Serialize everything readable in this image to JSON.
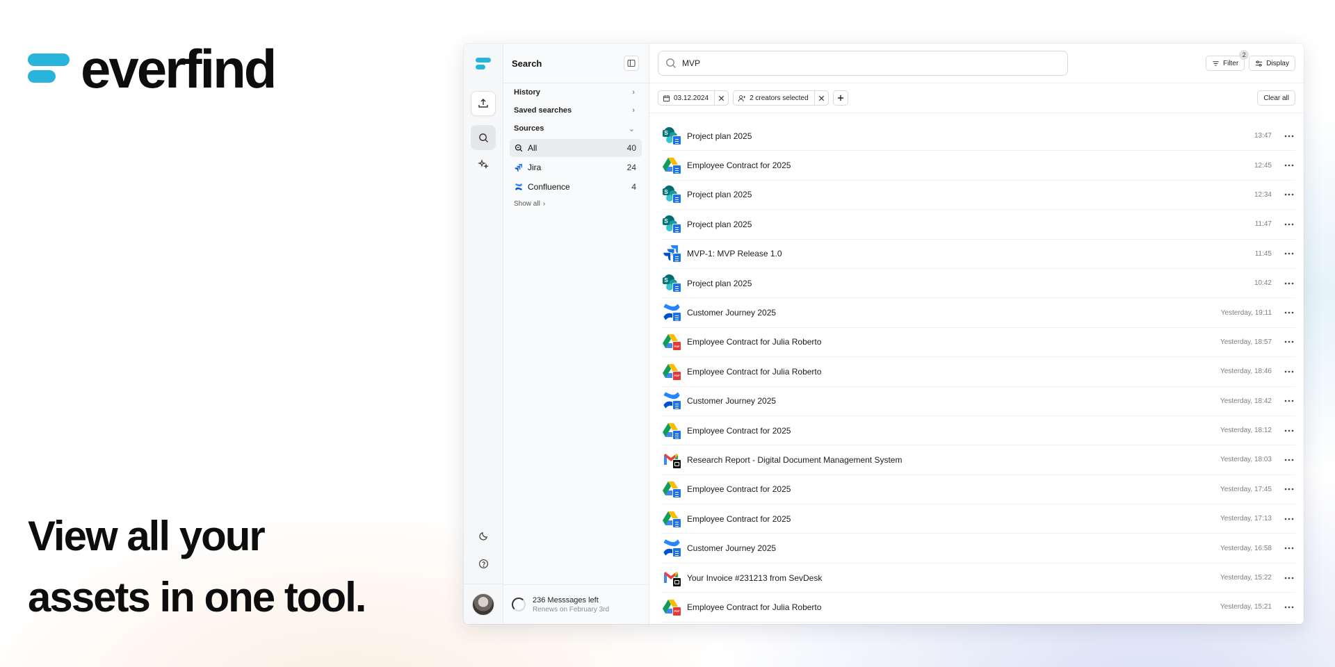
{
  "brand": {
    "name": "everfind"
  },
  "headline": {
    "line1": "View all your",
    "line2": "assets in one tool."
  },
  "colors": {
    "brand": "#29b4dc",
    "sharepoint": "#036c70",
    "docs": "#1a73e8",
    "pdf": "#e53935",
    "confluence": "#2684ff"
  },
  "rail": {
    "icons": [
      "upload-icon",
      "search-icon",
      "sparkle-icon",
      "moon-icon",
      "help-icon"
    ]
  },
  "sidebar": {
    "title": "Search",
    "sections": [
      {
        "label": "History"
      },
      {
        "label": "Saved searches"
      },
      {
        "label": "Sources"
      }
    ],
    "sources": [
      {
        "label": "All",
        "count": "40",
        "icon": "search-all-icon"
      },
      {
        "label": "Jira",
        "count": "24",
        "icon": "jira-icon"
      },
      {
        "label": "Confluence",
        "count": "4",
        "icon": "confluence-icon"
      }
    ],
    "show_all": "Show all",
    "footer": {
      "messages": "236 Messsages left",
      "renews": "Renews on February 3rd"
    }
  },
  "search": {
    "value": "MVP",
    "placeholder": ""
  },
  "toolbar": {
    "filter_label": "Filter",
    "filter_badge": "2",
    "display_label": "Display"
  },
  "filters": {
    "date_chip": "03.12.2024",
    "creators_chip": "2 creators selected",
    "clear_all": "Clear all"
  },
  "results": [
    {
      "title": "Project plan 2025",
      "time": "13:47",
      "source": "sharepoint",
      "doc": "doc"
    },
    {
      "title": "Employee Contract for 2025",
      "time": "12:45",
      "source": "gdrive",
      "doc": "doc"
    },
    {
      "title": "Project plan 2025",
      "time": "12:34",
      "source": "sharepoint",
      "doc": "doc"
    },
    {
      "title": "Project plan 2025",
      "time": "11:47",
      "source": "sharepoint",
      "doc": "doc"
    },
    {
      "title": "MVP-1: MVP Release 1.0",
      "time": "11:45",
      "source": "jira",
      "doc": "doc"
    },
    {
      "title": "Project plan 2025",
      "time": "10:42",
      "source": "sharepoint",
      "doc": "doc"
    },
    {
      "title": "Customer Journey 2025",
      "time": "Yesterday, 19:11",
      "source": "confluence",
      "doc": "doc"
    },
    {
      "title": "Employee Contract for Julia Roberto",
      "time": "Yesterday, 18:57",
      "source": "gdrive",
      "doc": "pdf"
    },
    {
      "title": "Employee Contract for Julia Roberto",
      "time": "Yesterday, 18:46",
      "source": "gdrive",
      "doc": "pdf"
    },
    {
      "title": "Customer Journey 2025",
      "time": "Yesterday, 18:42",
      "source": "confluence",
      "doc": "doc"
    },
    {
      "title": "Employee Contract for 2025",
      "time": "Yesterday, 18:12",
      "source": "gdrive",
      "doc": "doc"
    },
    {
      "title": "Research Report - Digital Document Management System",
      "time": "Yesterday, 18:03",
      "source": "gmail",
      "doc": "mail"
    },
    {
      "title": "Employee Contract for 2025",
      "time": "Yesterday, 17:45",
      "source": "gdrive",
      "doc": "doc"
    },
    {
      "title": "Employee Contract for 2025",
      "time": "Yesterday, 17:13",
      "source": "gdrive",
      "doc": "doc"
    },
    {
      "title": "Customer Journey 2025",
      "time": "Yesterday, 16:58",
      "source": "confluence",
      "doc": "doc"
    },
    {
      "title": "Your Invoice #231213 from SevDesk",
      "time": "Yesterday, 15:22",
      "source": "gmail",
      "doc": "mail"
    },
    {
      "title": "Employee Contract for Julia Roberto",
      "time": "Yesterday, 15:21",
      "source": "gdrive",
      "doc": "pdf"
    }
  ]
}
